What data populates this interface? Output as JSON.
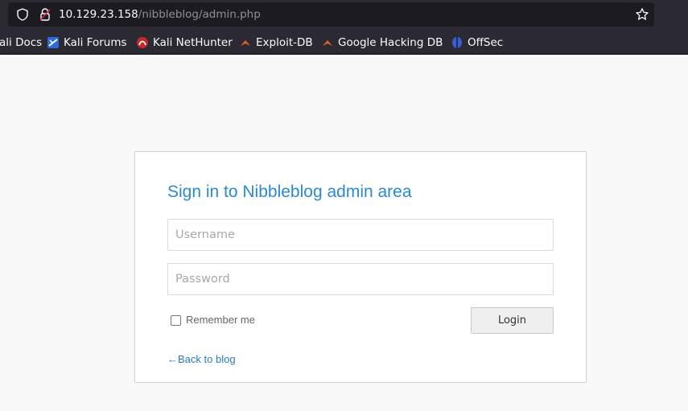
{
  "browser": {
    "url_host": "10.129.23.158",
    "url_path": "/nibbleblog/admin.php",
    "bookmarks": [
      {
        "label": "ali Docs",
        "icon": "kali-docs-icon"
      },
      {
        "label": "Kali Forums",
        "icon": "kali-forums-icon"
      },
      {
        "label": "Kali NetHunter",
        "icon": "kali-nethunter-icon"
      },
      {
        "label": "Exploit-DB",
        "icon": "exploit-db-icon"
      },
      {
        "label": "Google Hacking DB",
        "icon": "ghdb-icon"
      },
      {
        "label": "OffSec",
        "icon": "offsec-icon"
      }
    ]
  },
  "login": {
    "title": "Sign in to Nibbleblog admin area",
    "username_placeholder": "Username",
    "password_placeholder": "Password",
    "remember_label": "Remember me",
    "login_button": "Login",
    "back_link": "←Back to blog"
  },
  "colors": {
    "accent": "#2a8ad2",
    "chrome_bg": "#2b2a33",
    "page_bg": "#f8f8f8"
  }
}
